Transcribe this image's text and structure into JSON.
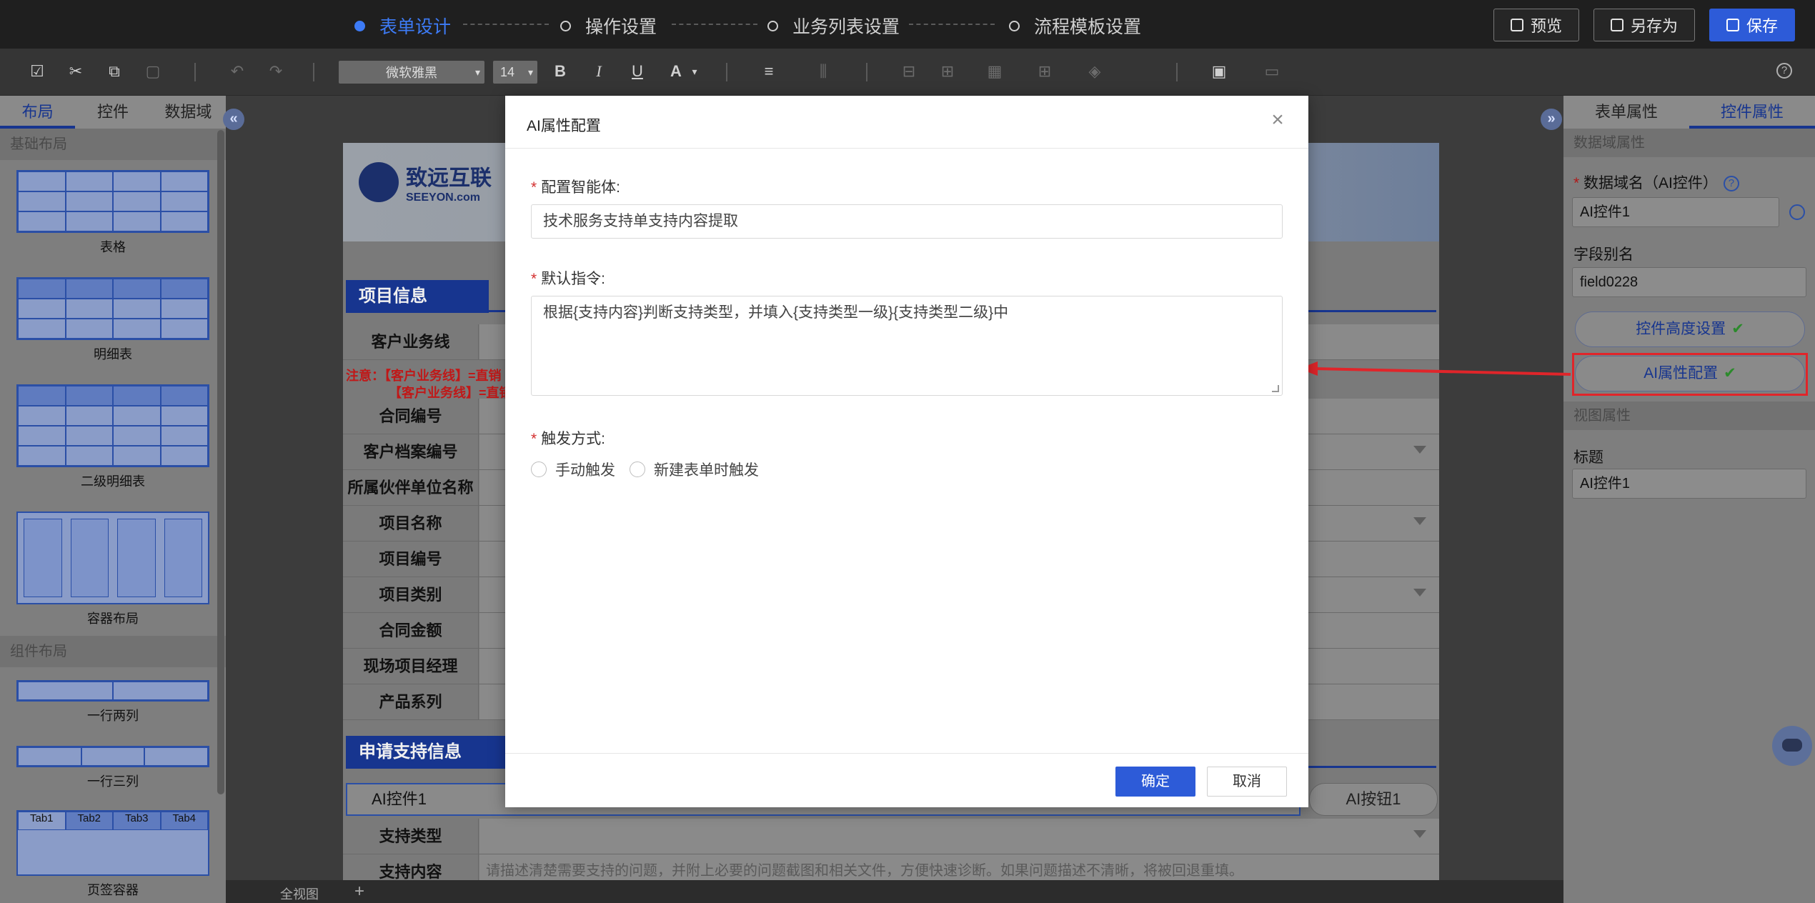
{
  "header": {
    "steps": [
      {
        "label": "表单设计",
        "active": true
      },
      {
        "label": "操作设置",
        "active": false
      },
      {
        "label": "业务列表设置",
        "active": false
      },
      {
        "label": "流程模板设置",
        "active": false
      }
    ],
    "preview_label": "预览",
    "save_as_label": "另存为",
    "save_label": "保存"
  },
  "toolbar": {
    "font_family": "微软雅黑",
    "font_size": "14",
    "bold": "B",
    "italic": "I",
    "underline": "U",
    "font_color": "A",
    "help": "?"
  },
  "left_panel": {
    "tabs": [
      "布局",
      "控件",
      "数据域"
    ],
    "section_basic": "基础布局",
    "section_component": "组件布局",
    "items": {
      "table": "表格",
      "detail_table": "明细表",
      "sub_detail_table": "二级明细表",
      "container": "容器布局",
      "one_row_two": "一行两列",
      "one_row_three": "一行三列",
      "tab_container": "页签容器"
    },
    "tab_labels": [
      "Tab1",
      "Tab2",
      "Tab3",
      "Tab4"
    ]
  },
  "form": {
    "logo_text": "致远互联",
    "logo_sub": "SEEYON.com",
    "section_project": "项目信息",
    "section_support": "申请支持信息",
    "note1": "注意：【客户业务线】=直销",
    "note2": "【客户业务线】=直销",
    "rows": [
      "客户业务线",
      "合同编号",
      "客户档案编号",
      "所属伙伴单位名称",
      "项目名称",
      "项目编号",
      "项目类别",
      "合同金额",
      "现场项目经理",
      "产品系列"
    ],
    "ai_control": "AI控件1",
    "ai_button": "AI按钮1",
    "support_type": "支持类型",
    "support_content": "支持内容",
    "support_placeholder": "请描述清楚需要支持的问题，并附上必要的问题截图和相关文件，方便快速诊断。如果问题描述不清晰，将被回退重填。"
  },
  "bottom": {
    "view_label": "全视图",
    "add": "+"
  },
  "right_panel": {
    "tabs": [
      "表单属性",
      "控件属性"
    ],
    "section_data": "数据域属性",
    "field_name_label": "数据域名（AI控件）",
    "field_name_value": "AI控件1",
    "alias_label": "字段别名",
    "alias_value": "field0228",
    "height_btn": "控件高度设置",
    "ai_btn": "AI属性配置",
    "section_view": "视图属性",
    "title_label": "标题",
    "title_value": "AI控件1"
  },
  "modal": {
    "title": "AI属性配置",
    "agent_label": "配置智能体:",
    "agent_value": "技术服务支持单支持内容提取",
    "instruction_label": "默认指令:",
    "instruction_value": "根据{支持内容}判断支持类型，并填入{支持类型一级}{支持类型二级}中",
    "trigger_label": "触发方式:",
    "trigger_options": [
      "手动触发",
      "新建表单时触发"
    ],
    "confirm": "确定",
    "cancel": "取消"
  },
  "colors": {
    "accent": "#2d5bd8",
    "highlight": "#e0252a",
    "success": "#2c8a2c"
  }
}
